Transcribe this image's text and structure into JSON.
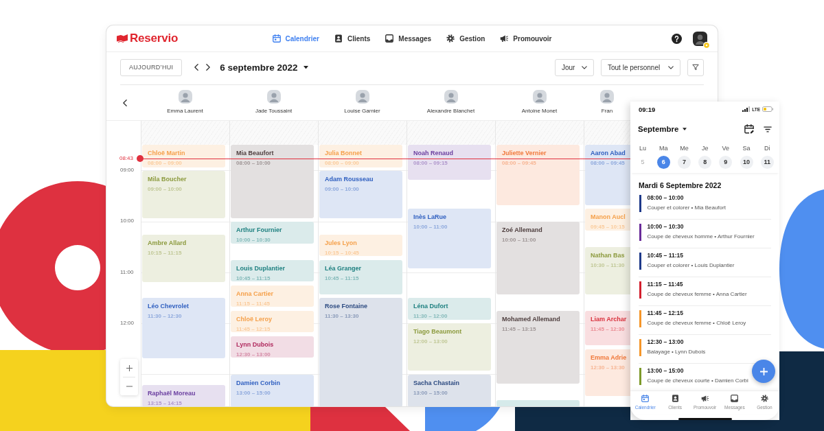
{
  "nav": {
    "logo": "Reservio",
    "items": [
      {
        "label": "Calendrier",
        "selected": true
      },
      {
        "label": "Clients",
        "selected": false
      },
      {
        "label": "Messages",
        "selected": false
      },
      {
        "label": "Gestion",
        "selected": false
      },
      {
        "label": "Promouvoir",
        "selected": false
      }
    ]
  },
  "toolbar": {
    "today": "AUJOURD’HUI",
    "date": "6 septembre 2022",
    "view": "Jour",
    "staff_filter": "Tout le personnel"
  },
  "staff": [
    {
      "name": "Emma Laurent"
    },
    {
      "name": "Jade Toussaint"
    },
    {
      "name": "Louise Garnier"
    },
    {
      "name": "Alexandre Blanchet"
    },
    {
      "name": "Antoine Monet"
    },
    {
      "name": "Fran"
    }
  ],
  "calendar": {
    "hours": [
      "09:00",
      "10:00",
      "11:00",
      "12:00"
    ],
    "now": "08:43",
    "columns": [
      {
        "events": [
          {
            "name": "Chloë Martin",
            "time": "08:00 – 09:00",
            "color": "#f5a04a"
          },
          {
            "name": "Mila Boucher",
            "time": "09:00 – 10:00",
            "color": "#8c9a3e"
          },
          {
            "name": "Ambre Allard",
            "time": "10:15 – 11:15",
            "color": "#8c9a3e"
          },
          {
            "name": "Léo Chevrolet",
            "time": "11:30 – 12:30",
            "color": "#3060c0"
          },
          {
            "name": "Raphaël Moreau",
            "time": "13:15 – 14:15",
            "color": "#6b3fa0"
          }
        ]
      },
      {
        "events": [
          {
            "name": "Mia Beaufort",
            "time": "08:00 – 10:00",
            "color": "#4e3e3e"
          },
          {
            "name": "Arthur Fournier",
            "time": "10:00 – 10:30",
            "color": "#1e8080"
          },
          {
            "name": "Louis Duplantier",
            "time": "10:45 – 11:15",
            "color": "#1e8080"
          },
          {
            "name": "Anna Cartier",
            "time": "11:15 – 11:45",
            "color": "#f5a04a"
          },
          {
            "name": "Chloë Leroy",
            "time": "11:45 – 12:15",
            "color": "#f5a04a"
          },
          {
            "name": "Lynn Dubois",
            "time": "12:30 – 13:00",
            "color": "#b02a5e"
          },
          {
            "name": "Damien Corbin",
            "time": "13:00 – 15:00",
            "color": "#3060c0"
          }
        ]
      },
      {
        "events": [
          {
            "name": "Julia Bonnet",
            "time": "08:00 – 09:00",
            "color": "#f5a04a"
          },
          {
            "name": "Adam Rousseau",
            "time": "09:00 – 10:00",
            "color": "#3060c0"
          },
          {
            "name": "Jules Lyon",
            "time": "10:15 – 10:45",
            "color": "#f5a04a"
          },
          {
            "name": "Léa Granger",
            "time": "10:45 – 11:15",
            "color": "#1e8080"
          },
          {
            "name": "Rose Fontaine",
            "time": "11:30 – 13:30",
            "color": "#2c4a80"
          }
        ]
      },
      {
        "events": [
          {
            "name": "Noah Renaud",
            "time": "08:00 – 09:15",
            "color": "#6b3fa0"
          },
          {
            "name": "Inès LaRue",
            "time": "10:00 – 11:00",
            "color": "#3060c0"
          },
          {
            "name": "Léna Dufort",
            "time": "11:30 – 12:00",
            "color": "#1e8080"
          },
          {
            "name": "Tiago Beaumont",
            "time": "12:00 – 13:00",
            "color": "#8c9a3e"
          },
          {
            "name": "Sacha Chastain",
            "time": "13:00 – 15:00",
            "color": "#2c4a80"
          }
        ]
      },
      {
        "events": [
          {
            "name": "Juliette Vernier",
            "time": "08:00 – 09:45",
            "color": "#f0783a"
          },
          {
            "name": "Zoé Allemand",
            "time": "10:00 – 11:00",
            "color": "#4e3e3e"
          },
          {
            "name": "Mohamed Allemand",
            "time": "11:45 – 13:15",
            "color": "#4e3e3e"
          },
          {
            "color": "#d6eaea"
          }
        ]
      },
      {
        "events": [
          {
            "name": "Aaron Abad",
            "time": "08:00 – 09:45",
            "color": "#3060c0"
          },
          {
            "name": "Manon Aucl",
            "time": "09:45 – 10:15",
            "color": "#f5a04a"
          },
          {
            "name": "Nathan Bas",
            "time": "10:30 – 11:30",
            "color": "#8c9a3e"
          },
          {
            "name": "Liam Archar",
            "time": "11:45 – 12:30",
            "color": "#d9303c"
          },
          {
            "name": "Emma Adrie",
            "time": "12:30 – 13:30",
            "color": "#f0783a"
          }
        ]
      }
    ]
  },
  "mobile": {
    "status_time": "09:19",
    "network": "LTE",
    "month": "Septembre",
    "week": [
      {
        "day": "Lu",
        "date": "5",
        "selected": false,
        "past": true
      },
      {
        "day": "Ma",
        "date": "6",
        "selected": true,
        "past": false
      },
      {
        "day": "Me",
        "date": "7",
        "selected": false,
        "past": false
      },
      {
        "day": "Je",
        "date": "8",
        "selected": false,
        "past": false
      },
      {
        "day": "Ve",
        "date": "9",
        "selected": false,
        "past": false
      },
      {
        "day": "Sa",
        "date": "10",
        "selected": false,
        "past": false
      },
      {
        "day": "Di",
        "date": "11",
        "selected": false,
        "past": false
      }
    ],
    "heading": "Mardi 6 Septembre 2022",
    "appointments": [
      {
        "time": "08:00 – 10:00",
        "detail": "Couper et colorer • Mia Beaufort",
        "color": "#1f3a8a"
      },
      {
        "time": "10:00 – 10:30",
        "detail": "Coupe de cheveux homme • Arthur Fournier",
        "color": "#6a2c9a"
      },
      {
        "time": "10:45 – 11:15",
        "detail": "Couper et colorer • Louis Duplantier",
        "color": "#1f3a8a"
      },
      {
        "time": "11:15 – 11:45",
        "detail": "Coupe de cheveux femme • Anna Cartier",
        "color": "#d3202e"
      },
      {
        "time": "11:45 – 12:15",
        "detail": "Coupe de cheveux femme • Chloë Leroy",
        "color": "#f5962a"
      },
      {
        "time": "12:30 – 13:00",
        "detail": "Balayage • Lynn Dubois",
        "color": "#f5962a"
      },
      {
        "time": "13:00 – 15:00",
        "detail": "Coupe de cheveux courte • Damien Corbi",
        "color": "#7d9a2a"
      }
    ],
    "tabs": [
      {
        "label": "Calendrier",
        "selected": true
      },
      {
        "label": "Clients",
        "selected": false
      },
      {
        "label": "Promouvoir",
        "selected": false
      },
      {
        "label": "Messages",
        "selected": false
      },
      {
        "label": "Gestion",
        "selected": false
      }
    ]
  }
}
